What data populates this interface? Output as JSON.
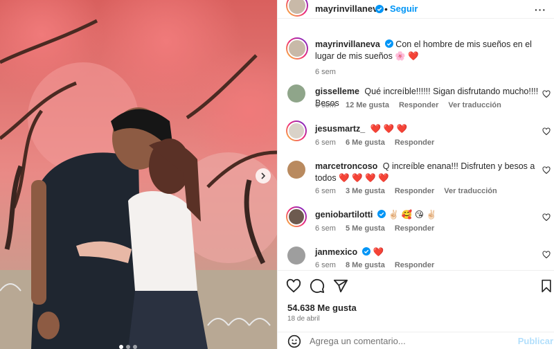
{
  "post": {
    "author": "mayrinvillaneva",
    "follow_label": "Seguir",
    "more_label": "···",
    "caption_user": "mayrinvillaneva",
    "caption_text": "Con el hombre de mis sueños en el lugar de mis sueños 🌸 ❤️",
    "caption_time": "6 sem"
  },
  "comments": [
    {
      "user": "gisselleme",
      "text": "Qué increíble!!!!!! Sigan disfrutando mucho!!!! Besos",
      "time": "6 sem",
      "likes": "12 Me gusta",
      "reply": "Responder",
      "translate": "Ver traducción",
      "verified": false
    },
    {
      "user": "jesusmartz_",
      "text": "❤️ ❤️ ❤️",
      "time": "6 sem",
      "likes": "6 Me gusta",
      "reply": "Responder",
      "translate": "",
      "verified": false
    },
    {
      "user": "marcetroncoso",
      "text": "Q increíble enana!!! Disfruten y besos a todos ❤️ ❤️ ❤️ ❤️",
      "time": "6 sem",
      "likes": "3 Me gusta",
      "reply": "Responder",
      "translate": "Ver traducción",
      "verified": false
    },
    {
      "user": "geniobartilotti",
      "text": "✌🏻 🥰 😘 ✌🏻",
      "time": "6 sem",
      "likes": "5 Me gusta",
      "reply": "Responder",
      "translate": "",
      "verified": true
    },
    {
      "user": "janmexico",
      "text": "❤️",
      "time": "6 sem",
      "likes": "8 Me gusta",
      "reply": "Responder",
      "translate": "",
      "verified": true
    }
  ],
  "footer": {
    "likes": "54.638 Me gusta",
    "date": "18 de abril",
    "comment_placeholder": "Agrega un comentario...",
    "publish_label": "Publicar"
  },
  "colors": {
    "accent": "#0095f6",
    "publish_disabled": "#b2dffc",
    "secondary_text": "#737373",
    "heart": "#ed4956"
  },
  "icons": [
    "verified-badge-icon",
    "heart-icon",
    "comment-icon",
    "share-icon",
    "bookmark-icon",
    "emoji-icon",
    "chevron-right-icon"
  ],
  "carousel": {
    "slides": 3,
    "active": 1
  }
}
